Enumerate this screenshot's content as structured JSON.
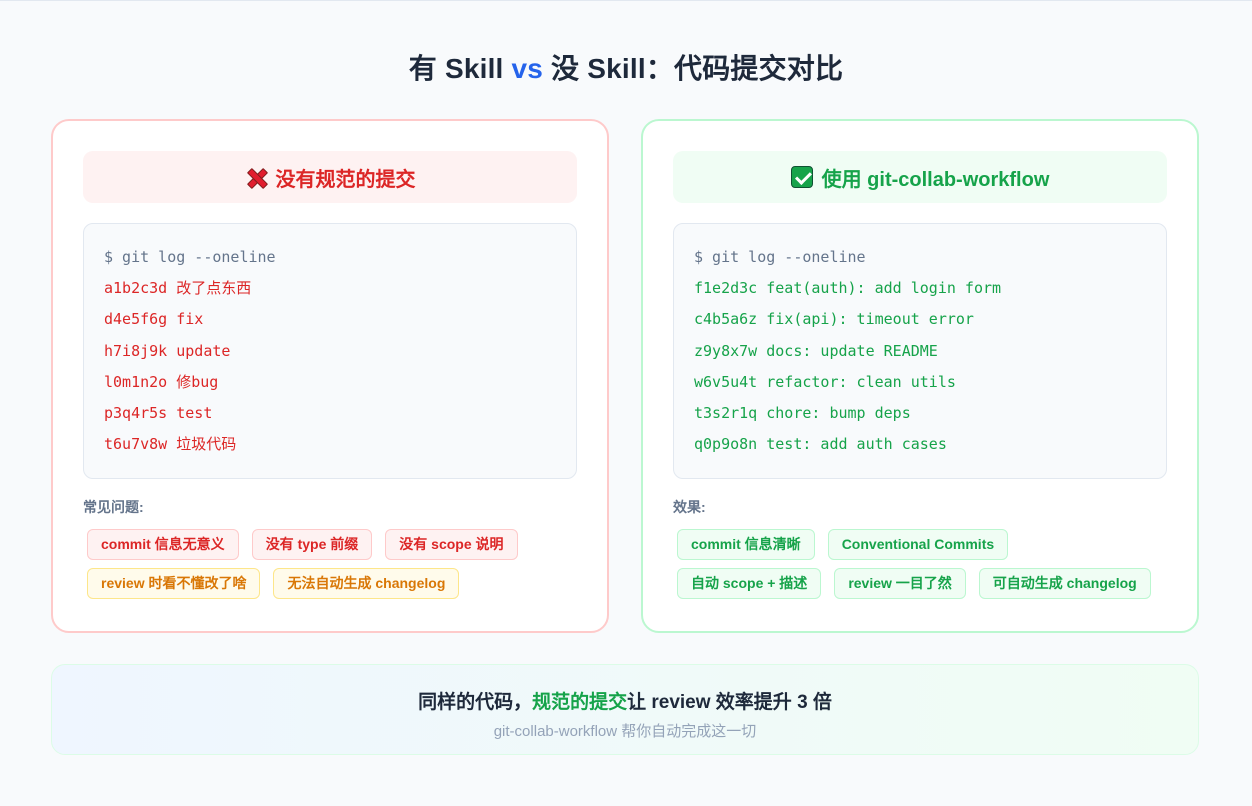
{
  "title": {
    "part1": "有 Skill ",
    "vs": "vs",
    "part2": " 没 Skill：代码提交对比"
  },
  "left": {
    "heading": "没有规范的提交",
    "command": "$ git log --oneline",
    "commits": [
      "a1b2c3d 改了点东西",
      "d4e5f6g fix",
      "h7i8j9k update",
      "l0m1n2o 修bug",
      "p3q4r5s test",
      "t6u7v8w 垃圾代码"
    ],
    "issues_label": "常见问题:",
    "issues_row1": [
      "commit 信息无意义",
      "没有 type 前缀",
      "没有 scope 说明"
    ],
    "issues_row2": [
      "review 时看不懂改了啥",
      "无法自动生成 changelog"
    ]
  },
  "right": {
    "heading": "使用 git-collab-workflow",
    "command": "$ git log --oneline",
    "commits": [
      "f1e2d3c feat(auth): add login form",
      "c4b5a6z fix(api): timeout error",
      "z9y8x7w docs: update README",
      "w6v5u4t refactor: clean utils",
      "t3s2r1q chore: bump deps",
      "q0p9o8n test: add auth cases"
    ],
    "effects_label": "效果:",
    "effects_row1": [
      "commit 信息清晰",
      "Conventional Commits"
    ],
    "effects_row2": [
      "自动 scope + 描述",
      "review 一目了然",
      "可自动生成 changelog"
    ]
  },
  "footer": {
    "main_pre": "同样的代码，",
    "main_highlight": "规范的提交",
    "main_post": "让 review 效率提升 3 倍",
    "sub": "git-collab-workflow 帮你自动完成这一切"
  },
  "icons": {
    "left_heading": "cross-mark-icon",
    "right_heading": "check-mark-icon"
  },
  "colors": {
    "accent_blue": "#2563eb",
    "bad_red": "#dc2626",
    "good_green": "#16a34a",
    "warn_amber": "#d97706"
  }
}
